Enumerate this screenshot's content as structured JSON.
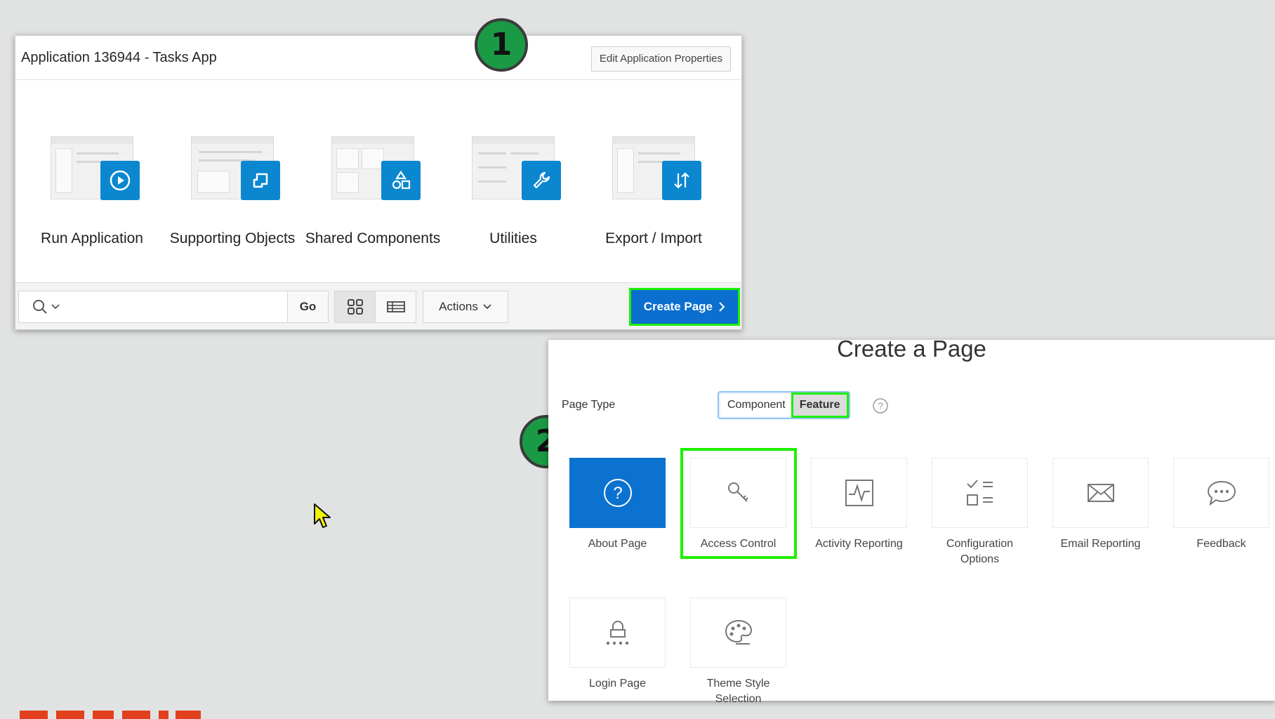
{
  "panel1": {
    "title": "Application 136944 - Tasks App",
    "edit_button": "Edit Application Properties",
    "tiles": [
      {
        "label": "Run Application",
        "icon": "play-icon"
      },
      {
        "label": "Supporting Objects",
        "icon": "scroll-icon"
      },
      {
        "label": "Shared Components",
        "icon": "shapes-icon"
      },
      {
        "label": "Utilities",
        "icon": "wrench-icon"
      },
      {
        "label": "Export / Import",
        "icon": "arrows-up-down-icon"
      }
    ],
    "toolbar": {
      "search_value": "",
      "go_label": "Go",
      "actions_label": "Actions",
      "create_page_label": "Create Page"
    }
  },
  "badges": {
    "one": "1",
    "two": "2"
  },
  "panel2": {
    "title": "Create a Page",
    "page_type_label": "Page Type",
    "segments": {
      "component": "Component",
      "feature": "Feature",
      "selected": "Feature"
    },
    "features": [
      {
        "label": "About Page",
        "icon": "question-icon"
      },
      {
        "label": "Access Control",
        "icon": "key-icon"
      },
      {
        "label": "Activity Reporting",
        "icon": "pulse-icon"
      },
      {
        "label": "Configuration Options",
        "icon": "checklist-icon"
      },
      {
        "label": "Email Reporting",
        "icon": "envelope-icon"
      },
      {
        "label": "Feedback",
        "icon": "speech-bubble-icon"
      },
      {
        "label": "Login Page",
        "icon": "lock-icon"
      },
      {
        "label": "Theme Style Selection",
        "icon": "palette-icon"
      }
    ]
  },
  "colors": {
    "accent": "#0b87cf",
    "primary_button": "#0b6fd0",
    "highlight": "#1cf000",
    "badge": "#1a9a45",
    "oracle": "#e2401c"
  }
}
